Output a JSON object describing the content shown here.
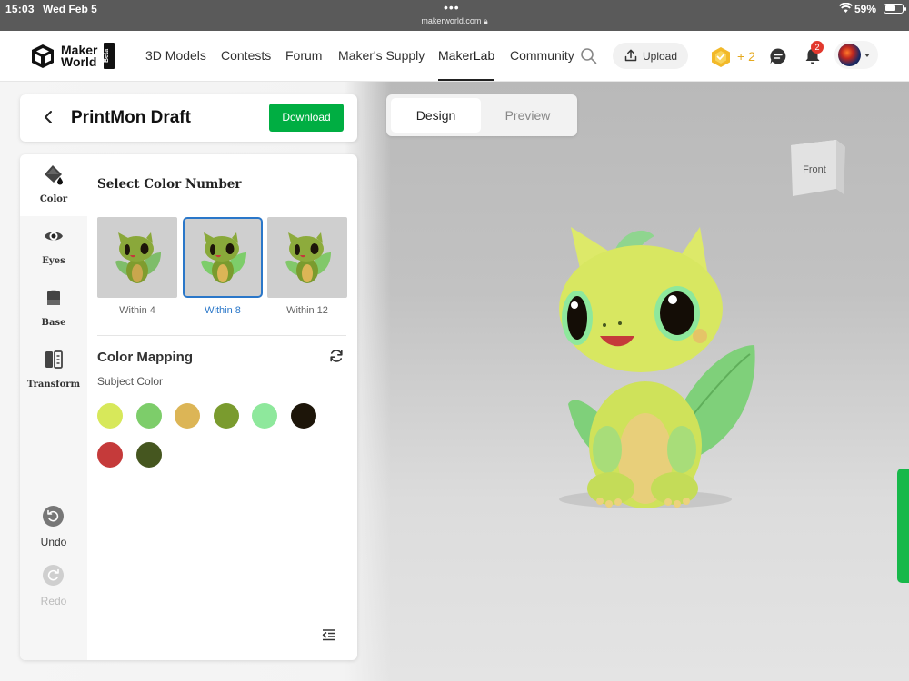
{
  "status_bar": {
    "time": "15:03",
    "date": "Wed Feb 5",
    "url": "makerworld.com",
    "battery": "59%"
  },
  "navbar": {
    "logo_line1": "Maker",
    "logo_line2": "World",
    "logo_badge": "Beta",
    "items": [
      {
        "label": "3D Models"
      },
      {
        "label": "Contests"
      },
      {
        "label": "Forum"
      },
      {
        "label": "Maker's Supply"
      },
      {
        "label": "MakerLab"
      },
      {
        "label": "Community"
      }
    ],
    "active_item": "MakerLab",
    "upload_label": "Upload",
    "points": "+ 2",
    "notification_count": "2"
  },
  "editor": {
    "title": "PrintMon Draft",
    "download_label": "Download",
    "mode_tabs": [
      {
        "label": "Design",
        "active": true
      },
      {
        "label": "Preview",
        "active": false
      }
    ],
    "view_cube_label": "Front"
  },
  "tools": [
    {
      "label": "Color",
      "icon": "paint-bucket-icon",
      "active": true
    },
    {
      "label": "Eyes",
      "icon": "eye-icon",
      "active": false
    },
    {
      "label": "Base",
      "icon": "base-icon",
      "active": false
    },
    {
      "label": "Transform",
      "icon": "transform-icon",
      "active": false
    }
  ],
  "history": {
    "undo_label": "Undo",
    "redo_label": "Redo"
  },
  "color_panel": {
    "select_title": "Select Color Number",
    "options": [
      {
        "label": "Within 4",
        "selected": false
      },
      {
        "label": "Within 8",
        "selected": true
      },
      {
        "label": "Within 12",
        "selected": false
      }
    ],
    "mapping_title": "Color Mapping",
    "subject_label": "Subject Color",
    "swatches": [
      "#d7e85a",
      "#7dcd6a",
      "#dcb556",
      "#7a9b2e",
      "#8ee89c",
      "#1d1509",
      "#c53a3a",
      "#45561f"
    ]
  },
  "colors": {
    "accent_green": "#00ae42",
    "selection_blue": "#2a77c9",
    "badge_red": "#e2382d",
    "points_gold": "#e5a91e"
  }
}
